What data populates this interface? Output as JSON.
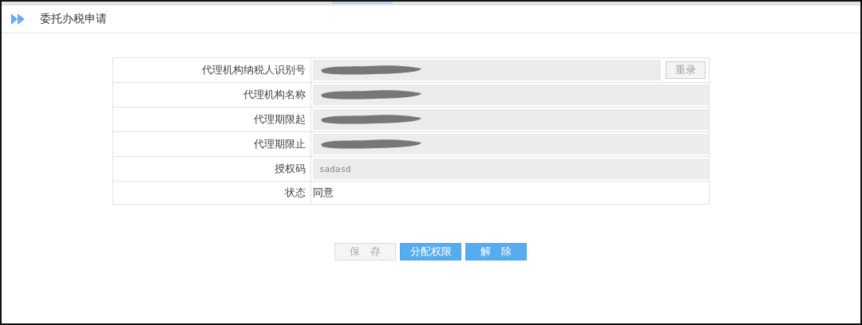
{
  "header": {
    "title": "委托办税申请"
  },
  "form": {
    "rows": [
      {
        "label": "代理机构纳税人识别号",
        "kind": "redacted",
        "action": "重录"
      },
      {
        "label": "代理机构名称",
        "kind": "redacted"
      },
      {
        "label": "代理期限起",
        "kind": "redacted"
      },
      {
        "label": "代理期限止",
        "kind": "redacted"
      },
      {
        "label": "授权码",
        "kind": "input",
        "value": "sadasd"
      },
      {
        "label": "状态",
        "kind": "text",
        "value": "同意"
      }
    ]
  },
  "buttons": [
    {
      "label": "保　存",
      "disabled": true
    },
    {
      "label": "分配权限",
      "disabled": false
    },
    {
      "label": "解　除",
      "disabled": false
    }
  ]
}
